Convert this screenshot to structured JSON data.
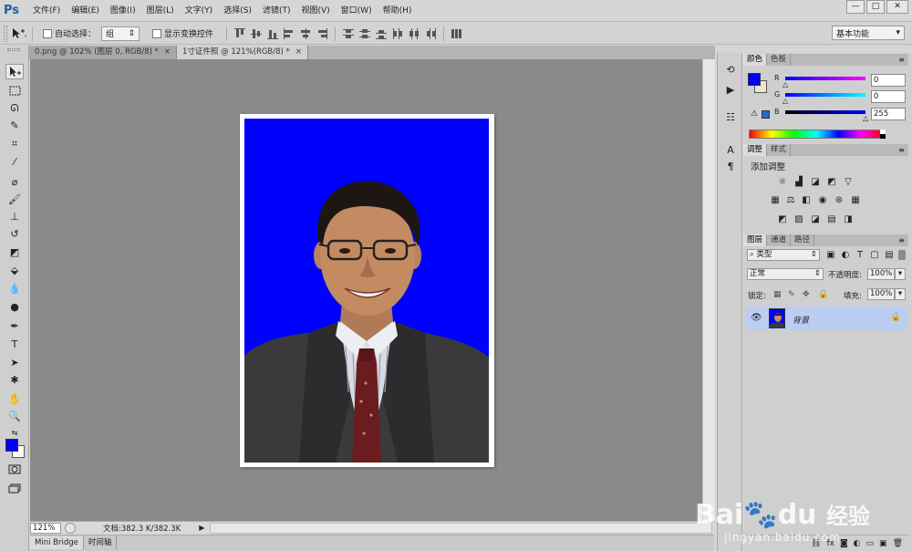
{
  "app": {
    "logo": "Ps",
    "menu": [
      "文件(F)",
      "编辑(E)",
      "图像(I)",
      "图层(L)",
      "文字(Y)",
      "选择(S)",
      "滤镜(T)",
      "视图(V)",
      "窗口(W)",
      "帮助(H)"
    ],
    "window_controls": [
      "—",
      "□",
      "✕"
    ]
  },
  "options": {
    "auto_select_label": "自动选择：",
    "auto_select_value": "组",
    "show_transform_label": "显示变换控件",
    "workspace": "基本功能"
  },
  "tabs": [
    {
      "label": "0.png @ 102% (图层 0, RGB/8) *",
      "close": "×",
      "active": false
    },
    {
      "label": "1寸证件照 @ 121%(RGB/8) *",
      "close": "×",
      "active": true
    }
  ],
  "status": {
    "zoom": "121%",
    "doc": "文档:382.3 K/382.3K"
  },
  "bottom_tabs": [
    "Mini Bridge",
    "时间轴"
  ],
  "color_panel": {
    "tabs": [
      "颜色",
      "色板"
    ],
    "fg_color": "#0000ff",
    "channels": [
      {
        "label": "R",
        "value": "0"
      },
      {
        "label": "G",
        "value": "0"
      },
      {
        "label": "B",
        "value": "255"
      }
    ]
  },
  "adjust_panel": {
    "tabs": [
      "调整",
      "样式"
    ],
    "title": "添加调整"
  },
  "layers_panel": {
    "tabs": [
      "图层",
      "通道",
      "路径"
    ],
    "filter_label": "类型",
    "blend_mode": "正常",
    "opacity_label": "不透明度:",
    "opacity_value": "100%",
    "lock_label": "锁定:",
    "fill_label": "填充:",
    "fill_value": "100%",
    "layers": [
      {
        "name": "背景",
        "visible": true,
        "locked": true
      }
    ]
  },
  "document": {
    "background_color": "#0000ff"
  },
  "watermark": {
    "brand_a": "Bai",
    "brand_b": "du",
    "brand_cn": "经验",
    "url": "jingyan.baidu.com"
  }
}
